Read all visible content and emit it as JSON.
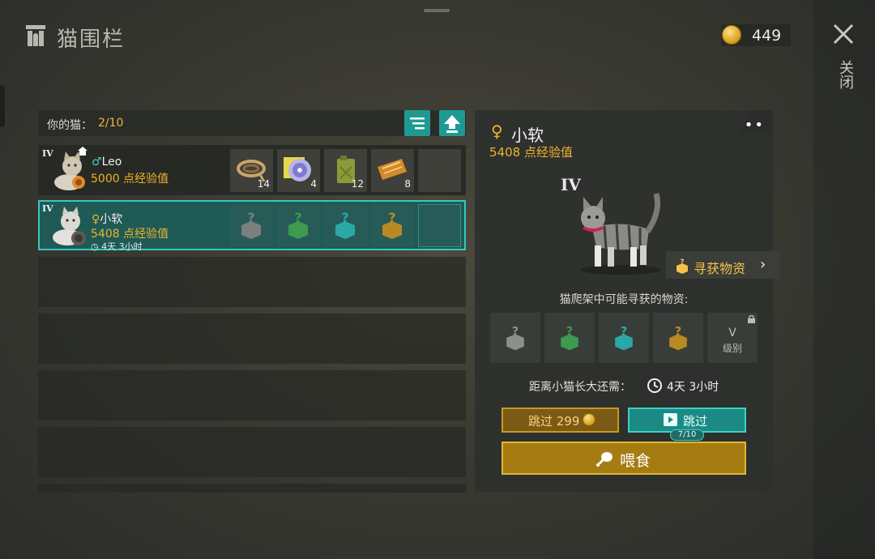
{
  "header": {
    "title": "猫围栏",
    "coins": "449",
    "close_label": "关闭"
  },
  "cat_list": {
    "label": "你的猫：",
    "count": "2/10",
    "cats": [
      {
        "tier": "IV",
        "gender_symbol": "♂",
        "name": "Leo",
        "exp": "5000 点经验值",
        "items": [
          {
            "icon": "rope-icon",
            "qty": "14"
          },
          {
            "icon": "cd-disc-icon",
            "qty": "4"
          },
          {
            "icon": "jerry-can-icon",
            "qty": "12"
          },
          {
            "icon": "coupon-ticket-icon",
            "qty": "8"
          }
        ]
      },
      {
        "tier": "IV",
        "gender_symbol": "♀",
        "name": "小软",
        "exp": "5408 点经验值",
        "time": "4天 3小时",
        "items": [
          {
            "icon": "mystery-box-gray-icon"
          },
          {
            "icon": "mystery-box-green-icon"
          },
          {
            "icon": "mystery-box-teal-icon"
          },
          {
            "icon": "mystery-box-gold-icon"
          }
        ]
      }
    ]
  },
  "detail": {
    "gender_symbol": "♀",
    "name": "小软",
    "exp": "5408 点经验值",
    "tier": "IV",
    "forage_label": "寻获物资",
    "possible_label": "猫爬架中可能寻获的物资:",
    "locked_tier": "V",
    "locked_level": "级别",
    "grow_label": "距离小猫长大还需：",
    "grow_time": "4天 3小时",
    "skip_coin_label": "跳过 299",
    "skip_ad_label": "跳过",
    "skip_ad_count": "7/10",
    "feed_label": "喂食"
  },
  "colors": {
    "accent_teal": "#1f9a92",
    "gold": "#f0b42c",
    "male": "#3fd0c4",
    "female": "#f0b42c"
  }
}
